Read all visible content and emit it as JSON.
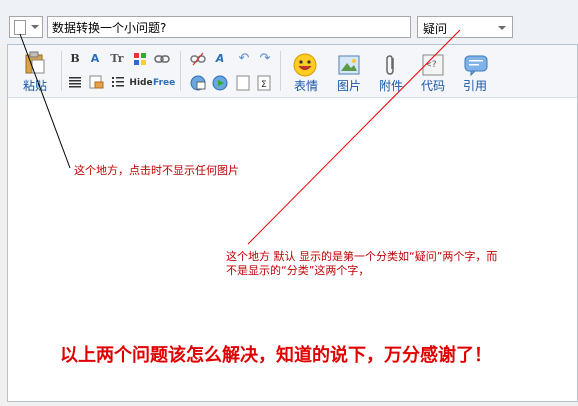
{
  "header": {
    "title_value": "数据转换一个小问题?",
    "category_value": "疑问"
  },
  "toolbar": {
    "paste_label": "粘贴",
    "emoticon_label": "表情",
    "image_label": "图片",
    "attachment_label": "附件",
    "code_label": "代码",
    "quote_label": "引用",
    "small_buttons": [
      "B",
      "A",
      "Tr",
      "link",
      "align",
      "list",
      "Hide",
      "Free"
    ]
  },
  "content": {
    "note1": "这个地方，点击时不显示任何图片",
    "note2_line1": "这个地方  默认 显示的是第一个分类如“疑问”两个字，而",
    "note2_line2": "不是显示的“分类”这两个字，",
    "big_note": "以上两个问题该怎么解决，知道的说下，万分感谢了！"
  }
}
